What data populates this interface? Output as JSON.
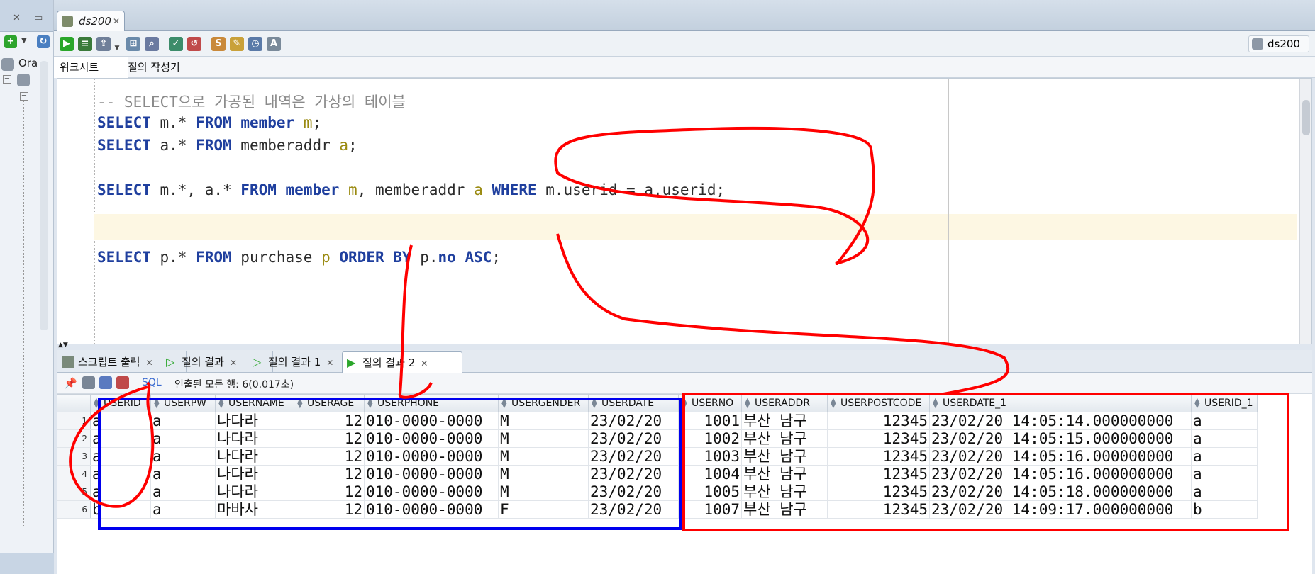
{
  "document_tab": {
    "title": "ds200"
  },
  "navigator": {
    "root_label": "Ora"
  },
  "toolbar": {
    "connection_label": "ds200"
  },
  "worksheet_tabs": [
    "워크시트",
    "질의 작성기"
  ],
  "editor": {
    "lines": [
      {
        "parts": [
          {
            "t": "-- SELECT으로 가공된 내역은 가상의 테이블",
            "c": "cm"
          }
        ]
      },
      {
        "parts": [
          {
            "t": "SELECT",
            "c": "kw"
          },
          {
            "t": " m.* ",
            "c": ""
          },
          {
            "t": "FROM",
            "c": "kw"
          },
          {
            "t": " ",
            "c": ""
          },
          {
            "t": "member",
            "c": "kw"
          },
          {
            "t": " ",
            "c": ""
          },
          {
            "t": "m",
            "c": "al"
          },
          {
            "t": ";",
            "c": ""
          }
        ]
      },
      {
        "parts": [
          {
            "t": "SELECT",
            "c": "kw"
          },
          {
            "t": " a.* ",
            "c": ""
          },
          {
            "t": "FROM",
            "c": "kw"
          },
          {
            "t": " memberaddr ",
            "c": ""
          },
          {
            "t": "a",
            "c": "al"
          },
          {
            "t": ";",
            "c": ""
          }
        ]
      },
      {
        "parts": []
      },
      {
        "parts": [
          {
            "t": "SELECT",
            "c": "kw"
          },
          {
            "t": " m.*, a.* ",
            "c": ""
          },
          {
            "t": "FROM",
            "c": "kw"
          },
          {
            "t": " ",
            "c": ""
          },
          {
            "t": "member",
            "c": "kw"
          },
          {
            "t": " ",
            "c": ""
          },
          {
            "t": "m",
            "c": "al"
          },
          {
            "t": ", memberaddr ",
            "c": ""
          },
          {
            "t": "a",
            "c": "al"
          },
          {
            "t": " ",
            "c": ""
          },
          {
            "t": "WHERE",
            "c": "kw"
          },
          {
            "t": " m.userid = a.userid;",
            "c": ""
          }
        ]
      },
      {
        "parts": []
      },
      {
        "parts": []
      },
      {
        "parts": [
          {
            "t": "SELECT",
            "c": "kw"
          },
          {
            "t": " p.* ",
            "c": ""
          },
          {
            "t": "FROM",
            "c": "kw"
          },
          {
            "t": " purchase ",
            "c": ""
          },
          {
            "t": "p",
            "c": "al"
          },
          {
            "t": " ",
            "c": ""
          },
          {
            "t": "ORDER BY",
            "c": "kw"
          },
          {
            "t": " p.",
            "c": ""
          },
          {
            "t": "no",
            "c": "kw"
          },
          {
            "t": " ",
            "c": ""
          },
          {
            "t": "ASC",
            "c": "kw"
          },
          {
            "t": ";",
            "c": ""
          }
        ]
      }
    ]
  },
  "result_tabs": [
    {
      "label": "스크립트 출력",
      "active": false
    },
    {
      "label": "질의 결과",
      "active": false
    },
    {
      "label": "질의 결과 1",
      "active": false
    },
    {
      "label": "질의 결과 2",
      "active": true
    }
  ],
  "result_toolbar": {
    "sql_label": "SQL",
    "status": "인출된 모든 행: 6(0.017초)"
  },
  "grid": {
    "columns": [
      "USERID",
      "USERPW",
      "USERNAME",
      "USERAGE",
      "USERPHONE",
      "USERGENDER",
      "USERDATE",
      "USERNO",
      "USERADDR",
      "USERPOSTCODE",
      "USERDATE_1",
      "USERID_1"
    ],
    "rows": [
      [
        "1",
        "a",
        "a",
        "나다라",
        "12",
        "010-0000-0000",
        "M",
        "23/02/20",
        "1001",
        "부산 남구",
        "12345",
        "23/02/20 14:05:14.000000000",
        "a"
      ],
      [
        "2",
        "a",
        "a",
        "나다라",
        "12",
        "010-0000-0000",
        "M",
        "23/02/20",
        "1002",
        "부산 남구",
        "12345",
        "23/02/20 14:05:15.000000000",
        "a"
      ],
      [
        "3",
        "a",
        "a",
        "나다라",
        "12",
        "010-0000-0000",
        "M",
        "23/02/20",
        "1003",
        "부산 남구",
        "12345",
        "23/02/20 14:05:16.000000000",
        "a"
      ],
      [
        "4",
        "a",
        "a",
        "나다라",
        "12",
        "010-0000-0000",
        "M",
        "23/02/20",
        "1004",
        "부산 남구",
        "12345",
        "23/02/20 14:05:16.000000000",
        "a"
      ],
      [
        "5",
        "a",
        "a",
        "나다라",
        "12",
        "010-0000-0000",
        "M",
        "23/02/20",
        "1005",
        "부산 남구",
        "12345",
        "23/02/20 14:05:18.000000000",
        "a"
      ],
      [
        "6",
        "b",
        "a",
        "마바사",
        "12",
        "010-0000-0000",
        "F",
        "23/02/20",
        "1007",
        "부산 남구",
        "12345",
        "23/02/20 14:09:17.000000000",
        "b"
      ]
    ]
  },
  "colors": {
    "annotation_red": "#ff0000",
    "annotation_blue": "#0000ee",
    "keyword_blue": "#1f3f9e"
  }
}
